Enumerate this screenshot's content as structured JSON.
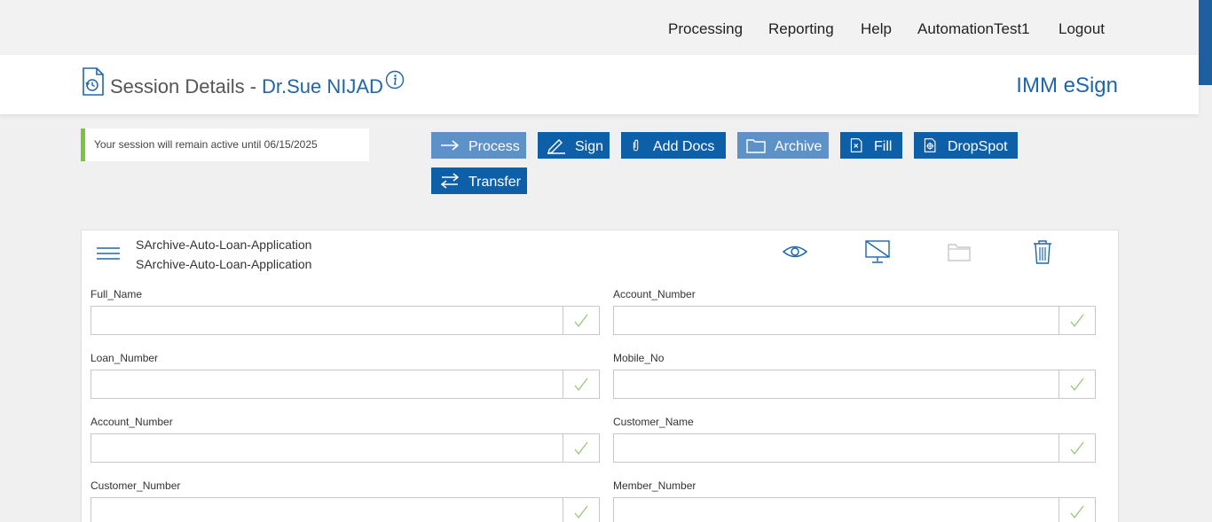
{
  "nav": {
    "items": [
      "Processing",
      "Reporting",
      "Help",
      "AutomationTest1",
      "Logout"
    ]
  },
  "header": {
    "title_label": "Session Details -",
    "title_name": "Dr.Sue NIJAD",
    "brand": "IMM eSign",
    "icons": [
      "document-history-icon",
      "info-icon"
    ]
  },
  "session": {
    "notice": "Your session will remain active until 06/15/2025"
  },
  "actions": {
    "process": "Process",
    "sign": "Sign",
    "add_docs": "Add Docs",
    "archive": "Archive",
    "fill": "Fill",
    "dropspot": "DropSpot",
    "transfer": "Transfer"
  },
  "document": {
    "name_line1": "SArchive-Auto-Loan-Application",
    "name_line2": "SArchive-Auto-Loan-Application",
    "tools": [
      "eye-icon",
      "monitor-off-icon",
      "folder-icon",
      "trash-icon"
    ]
  },
  "fields": [
    {
      "label": "Full_Name",
      "value": ""
    },
    {
      "label": "Account_Number",
      "value": ""
    },
    {
      "label": "Loan_Number",
      "value": ""
    },
    {
      "label": "Mobile_No",
      "value": ""
    },
    {
      "label": "Account_Number",
      "value": ""
    },
    {
      "label": "Customer_Name",
      "value": ""
    },
    {
      "label": "Customer_Number",
      "value": ""
    },
    {
      "label": "Member_Number",
      "value": ""
    }
  ],
  "colors": {
    "primary": "#0d5fa8",
    "primary_light": "#5c92c8",
    "accent_green": "#7dc242",
    "link_blue": "#1f66a8"
  }
}
